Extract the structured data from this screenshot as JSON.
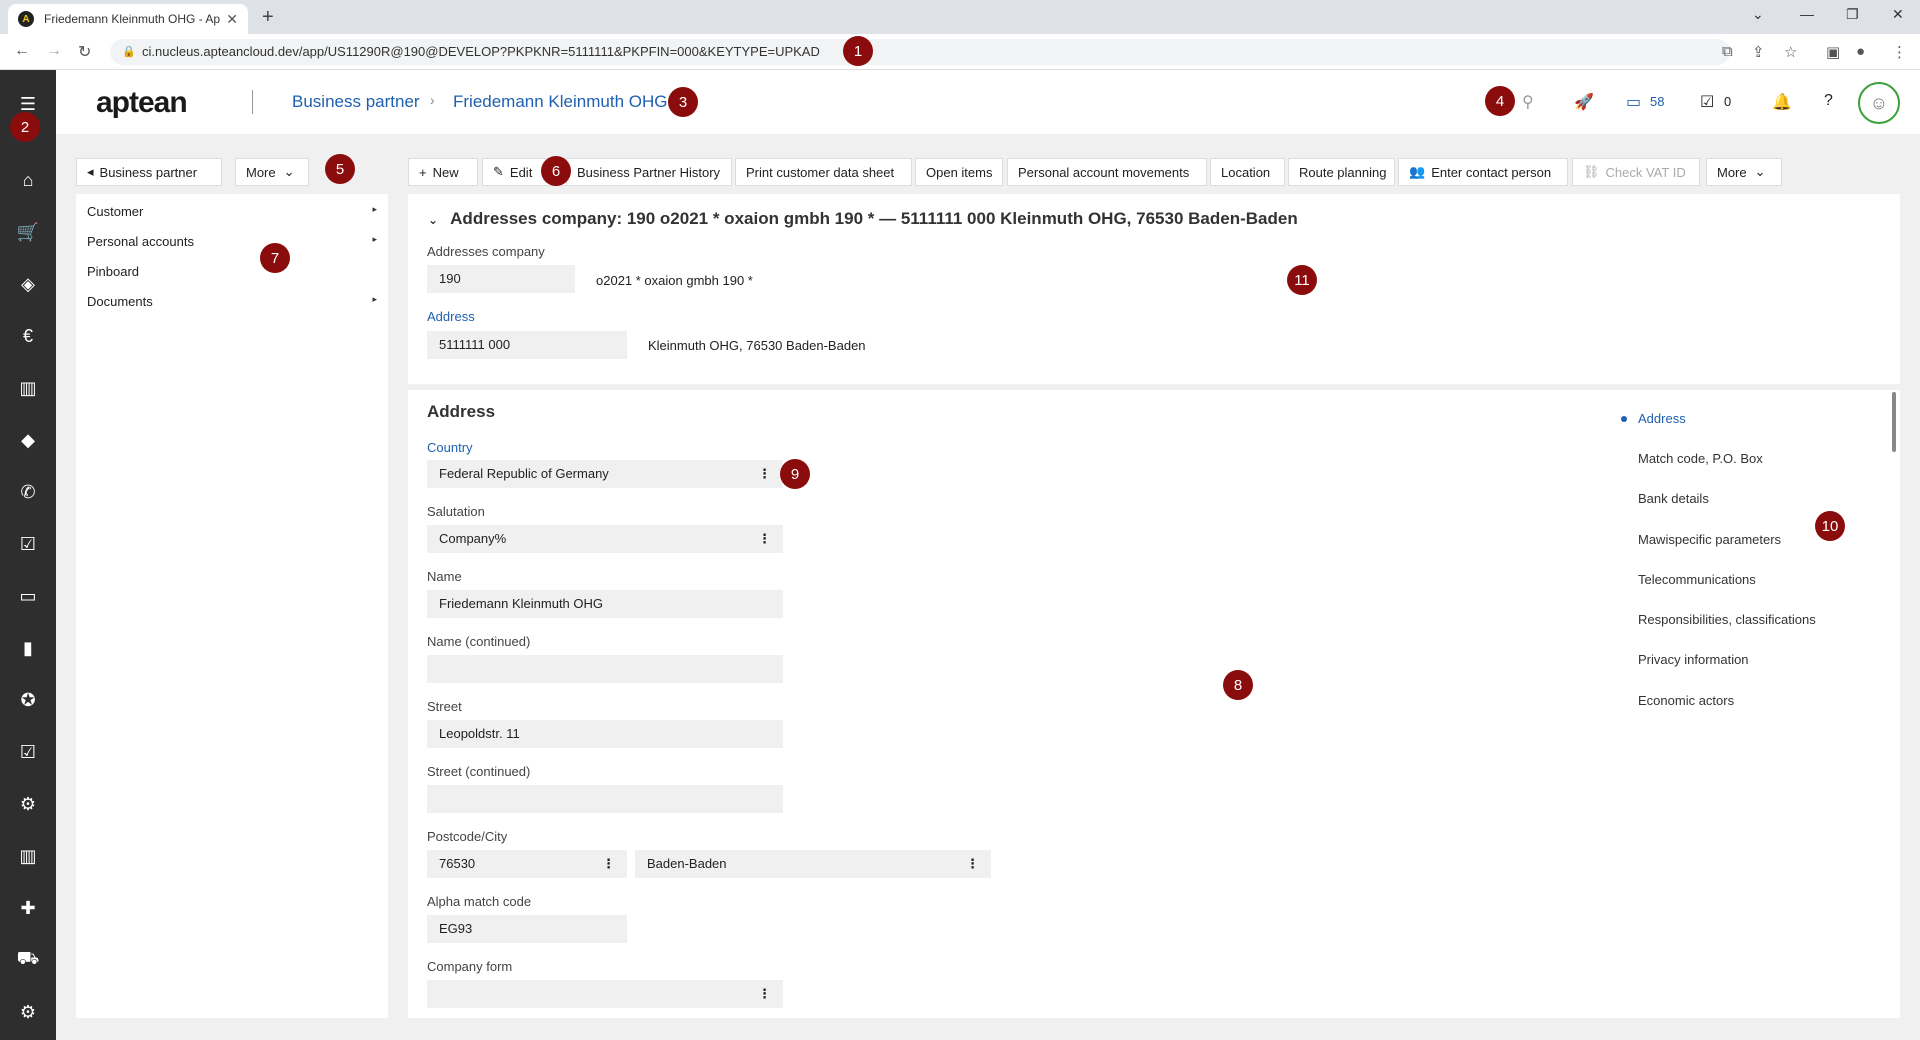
{
  "browser": {
    "tab_title": "Friedemann Kleinmuth OHG - Ap",
    "url": "ci.nucleus.apteancloud.dev/app/US11290R@190@DEVELOP?PKPKNR=5111111&PKPFIN=000&KEYTYPE=UPKAD"
  },
  "header": {
    "logo": "aptean",
    "breadcrumb_1": "Business partner",
    "breadcrumb_2": "Friedemann Kleinmuth OHG",
    "inbox_count": "58",
    "tasks_count": "0"
  },
  "left_toolbar": {
    "back_label": "Business partner",
    "more_label": "More"
  },
  "toolbar": {
    "new": "New",
    "edit": "Edit",
    "history": "Business Partner History",
    "print": "Print customer data sheet",
    "open_items": "Open items",
    "movements": "Personal account movements",
    "location": "Location",
    "route": "Route planning",
    "contact": "Enter contact person",
    "vat": "Check VAT ID",
    "more": "More"
  },
  "leftnav": {
    "items": [
      "Customer",
      "Personal accounts",
      "Pinboard",
      "Documents"
    ]
  },
  "addresses_section": {
    "title": "Addresses company: 190 o2021 * oxaion gmbh 190 * — 5111111 000 Kleinmuth OHG, 76530 Baden-Baden",
    "company_label": "Addresses company",
    "company_value": "190",
    "company_desc": "o2021 * oxaion gmbh 190 *",
    "address_label": "Address",
    "address_value": "5111111 000",
    "address_desc": "Kleinmuth OHG, 76530 Baden-Baden"
  },
  "address_form": {
    "title": "Address",
    "country_label": "Country",
    "country_value": "Federal Republic of Germany",
    "salutation_label": "Salutation",
    "salutation_value": "Company%",
    "name_label": "Name",
    "name_value": "Friedemann Kleinmuth OHG",
    "name2_label": "Name (continued)",
    "name2_value": "",
    "street_label": "Street",
    "street_value": "Leopoldstr. 11",
    "street2_label": "Street (continued)",
    "street2_value": "",
    "postcode_label": "Postcode/City",
    "postcode_value": "76530",
    "city_value": "Baden-Baden",
    "alpha_label": "Alpha match code",
    "alpha_value": "EG93",
    "companyform_label": "Company form",
    "companyform_value": ""
  },
  "toc": {
    "items": [
      "Address",
      "Match code, P.O. Box",
      "Bank details",
      "Mawispecific parameters",
      "Telecommunications",
      "Responsibilities, classifications",
      "Privacy information",
      "Economic actors"
    ]
  },
  "markers": [
    "1",
    "2",
    "3",
    "4",
    "5",
    "6",
    "7",
    "8",
    "9",
    "10",
    "11"
  ]
}
